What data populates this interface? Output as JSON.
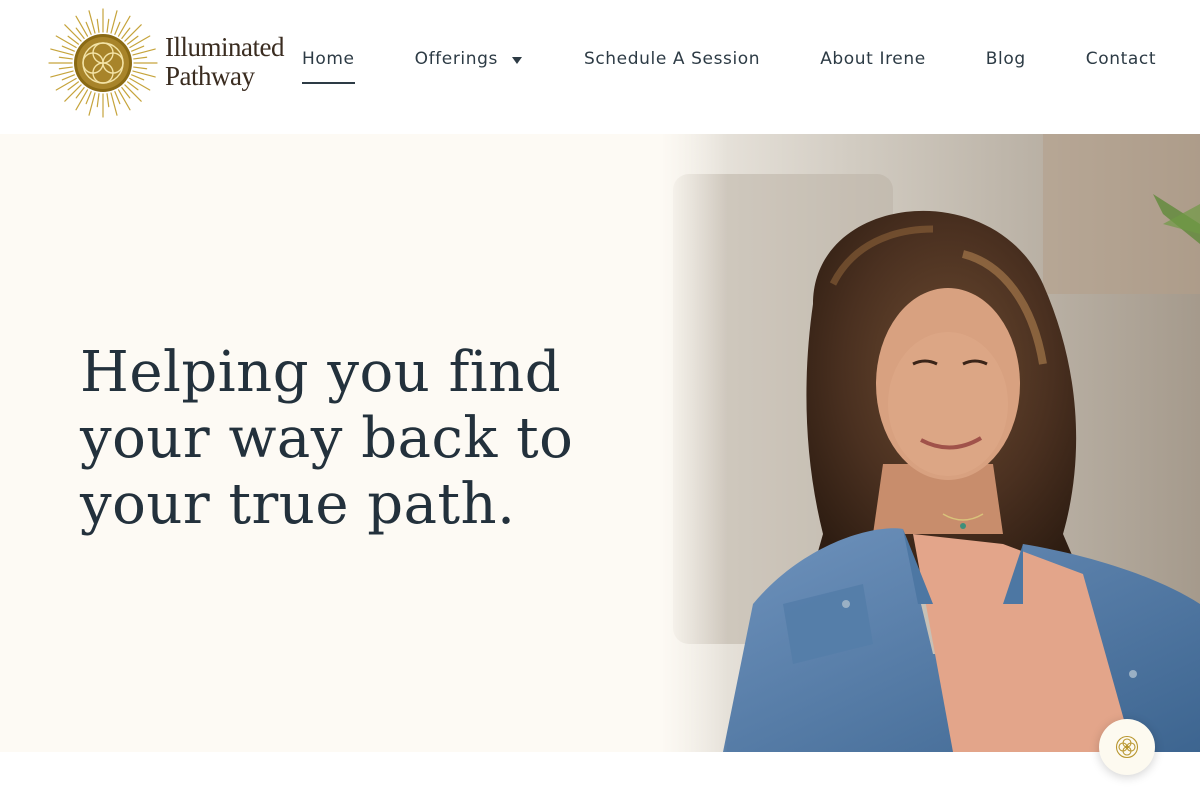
{
  "brand": {
    "name_line1": "Illuminated",
    "name_line2": "Pathway",
    "logo_icon": "sunburst-flower-of-life-icon",
    "gold": "#b8962e",
    "text_dark": "#3a2c20"
  },
  "nav": {
    "items": [
      {
        "label": "Home",
        "active": true
      },
      {
        "label": "Offerings",
        "has_dropdown": true
      },
      {
        "label": "Schedule A Session"
      },
      {
        "label": "About Irene"
      },
      {
        "label": "Blog"
      },
      {
        "label": "Contact"
      }
    ],
    "text_color": "#2d3b45"
  },
  "hero": {
    "headline": "Helping you find your way back to your true path.",
    "background": "#fdfaf4",
    "headline_color": "#23313c",
    "photo_alt": "Portrait of Irene smiling, wearing a denim jacket and peach top"
  },
  "chat_widget": {
    "icon": "flower-of-life-icon"
  }
}
